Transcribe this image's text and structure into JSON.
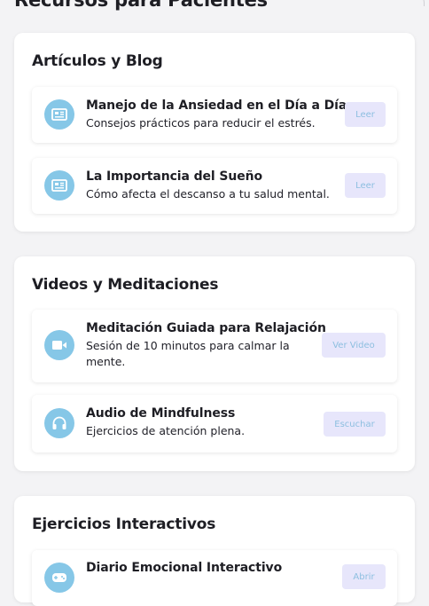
{
  "page": {
    "title": "Recursos para Pacientes"
  },
  "colors": {
    "accent": "#86c7e7",
    "button_bg": "#e7e6fb",
    "button_text": "#8dbfe0",
    "background": "#f3f3f5"
  },
  "sections": [
    {
      "title": "Artículos y Blog",
      "items": [
        {
          "icon": "newspaper-icon",
          "title": "Manejo de la Ansiedad en el Día a Día",
          "description": "Consejos prácticos para reducir el estrés.",
          "action": "Leer"
        },
        {
          "icon": "newspaper-icon",
          "title": "La Importancia del Sueño",
          "description": "Cómo afecta el descanso a tu salud mental.",
          "action": "Leer"
        }
      ]
    },
    {
      "title": "Videos y Meditaciones",
      "items": [
        {
          "icon": "video-camera-icon",
          "title": "Meditación Guiada para Relajación",
          "description": "Sesión de 10 minutos para calmar la mente.",
          "action": "Ver Video"
        },
        {
          "icon": "headphones-icon",
          "title": "Audio de Mindfulness",
          "description": "Ejercicios de atención plena.",
          "action": "Escuchar"
        }
      ]
    },
    {
      "title": "Ejercicios Interactivos",
      "items": [
        {
          "icon": "gamepad-icon",
          "title": "Diario Emocional Interactivo",
          "description": "",
          "action": "Abrir"
        }
      ]
    }
  ]
}
